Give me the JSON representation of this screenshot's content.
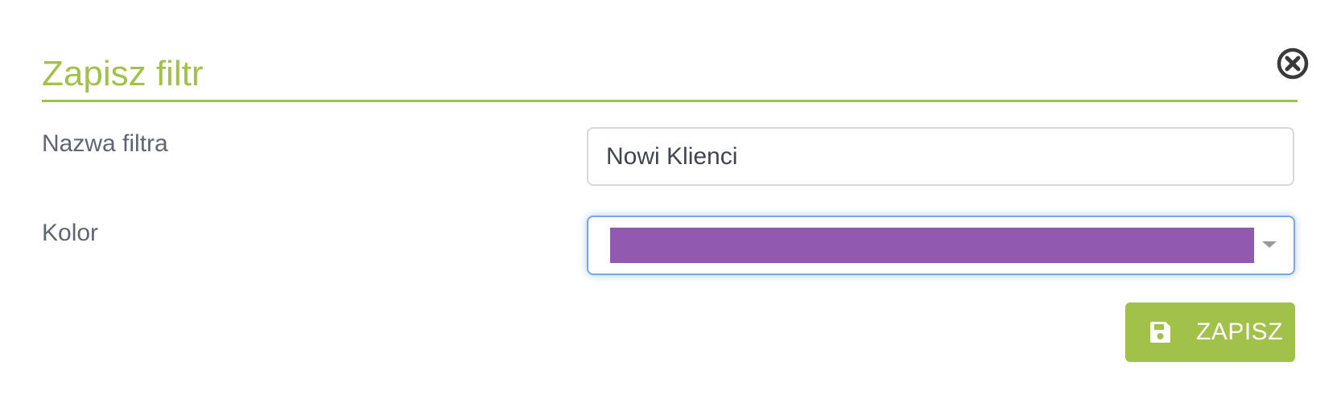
{
  "dialog": {
    "title": "Zapisz filtr",
    "accent_color": "#a2c14a",
    "close_icon": "close-circle-icon"
  },
  "form": {
    "name_label": "Nazwa filtra",
    "name_value": "Nowi Klienci",
    "color_label": "Kolor",
    "color_value": "#915ab0",
    "color_dropdown_icon": "caret-down-icon"
  },
  "actions": {
    "save_label": "ZAPISZ",
    "save_icon": "floppy-disk-icon",
    "save_color": "#a2c14a"
  }
}
